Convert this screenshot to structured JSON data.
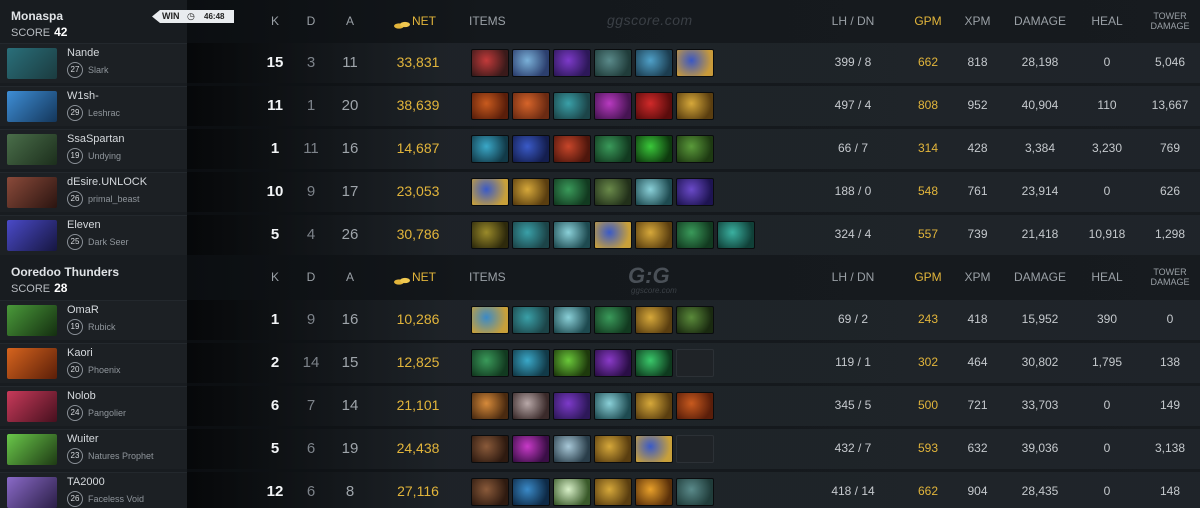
{
  "match": {
    "result": "WIN",
    "duration": "46:48",
    "watermark": "ggscore.com",
    "logo": "G:G",
    "logo_sub": "ggscore.com"
  },
  "colors": {
    "gold": "#e2b53b",
    "background": "#0d1013"
  },
  "headers": {
    "k": "K",
    "d": "D",
    "a": "A",
    "net": "NET",
    "items": "ITEMS",
    "lhdn": "LH / DN",
    "gpm": "GPM",
    "xpm": "XPM",
    "damage": "DAMAGE",
    "heal": "HEAL",
    "tower1": "TOWER",
    "tower2": "DAMAGE",
    "score_label": "SCORE"
  },
  "teams": [
    {
      "name": "Monaspa",
      "score": "42",
      "players": [
        {
          "name": "Nande",
          "level": "27",
          "hero": "Slark",
          "k": "15",
          "d": "3",
          "a": "11",
          "net": "33,831",
          "lhdn": "399 / 8",
          "gpm": "662",
          "xpm": "818",
          "damage": "28,198",
          "heal": "0",
          "tower": "5,046",
          "portrait": [
            "#2a6f7a",
            "#1b3b3f"
          ],
          "items": [
            [
              "#c23a3a",
              "#3a1a1a"
            ],
            [
              "#7ab0d8",
              "#2c3f6e"
            ],
            [
              "#7d3ac9",
              "#2d1859"
            ],
            [
              "#5a8a8a",
              "#203c3a"
            ],
            [
              "#4fa0c8",
              "#1c3d50"
            ],
            [
              "#3a57c4",
              "#c89a3a"
            ]
          ]
        },
        {
          "name": "W1sh-",
          "level": "29",
          "hero": "Leshrac",
          "k": "11",
          "d": "1",
          "a": "20",
          "net": "38,639",
          "lhdn": "497 / 4",
          "gpm": "808",
          "xpm": "952",
          "damage": "40,904",
          "heal": "110",
          "tower": "13,667",
          "portrait": [
            "#3e8ed6",
            "#14365a"
          ],
          "items": [
            [
              "#c85a1e",
              "#5a1e0a"
            ],
            [
              "#d6642a",
              "#6a2a12"
            ],
            [
              "#3aa0a8",
              "#1c4448"
            ],
            [
              "#b83ac0",
              "#461452"
            ],
            [
              "#d02a2a",
              "#5a0c0c"
            ],
            [
              "#d6a83a",
              "#5a3e10"
            ]
          ]
        },
        {
          "name": "SsaSpartan",
          "level": "19",
          "hero": "Undying",
          "k": "1",
          "d": "11",
          "a": "16",
          "net": "14,687",
          "lhdn": "66 / 7",
          "gpm": "314",
          "xpm": "428",
          "damage": "3,384",
          "heal": "3,230",
          "tower": "769",
          "portrait": [
            "#4a6e4a",
            "#1c2e1c"
          ],
          "items": [
            [
              "#3aa8c8",
              "#123a48"
            ],
            [
              "#3a5ac8",
              "#141e4e"
            ],
            [
              "#c8462a",
              "#4e160c"
            ],
            [
              "#3a9a5a",
              "#123a20"
            ],
            [
              "#3ac83a",
              "#0e3a0e"
            ],
            [
              "#5a9a3a",
              "#1e3a12"
            ]
          ]
        },
        {
          "name": "dEsire.UNLOCK",
          "level": "26",
          "hero": "primal_beast",
          "k": "10",
          "d": "9",
          "a": "17",
          "net": "23,053",
          "lhdn": "188 / 0",
          "gpm": "548",
          "xpm": "761",
          "damage": "23,914",
          "heal": "0",
          "tower": "626",
          "portrait": [
            "#8a4a3a",
            "#2a1410"
          ],
          "items": [
            [
              "#3a5ac8",
              "#c8a03a"
            ],
            [
              "#d6a83a",
              "#5a3e10"
            ],
            [
              "#3a9a5a",
              "#123a20"
            ],
            [
              "#6a8a4a",
              "#22301a"
            ],
            [
              "#8ad0d8",
              "#1e4a50"
            ],
            [
              "#6a4ac8",
              "#1e1452"
            ]
          ]
        },
        {
          "name": "Eleven",
          "level": "25",
          "hero": "Dark Seer",
          "k": "5",
          "d": "4",
          "a": "26",
          "net": "30,786",
          "lhdn": "324 / 4",
          "gpm": "557",
          "xpm": "739",
          "damage": "21,418",
          "heal": "10,918",
          "tower": "1,298",
          "portrait": [
            "#4a4ac8",
            "#161640"
          ],
          "items": [
            [
              "#9a8a2a",
              "#2e2a0c"
            ],
            [
              "#3aa0a8",
              "#1c4448"
            ],
            [
              "#8ad0d8",
              "#1e4a50"
            ],
            [
              "#3a5ac8",
              "#c8a03a"
            ],
            [
              "#d6a83a",
              "#5a3e10"
            ],
            [
              "#3a9a5a",
              "#123a20"
            ],
            [
              "#3ab0a0",
              "#104038"
            ]
          ]
        }
      ]
    },
    {
      "name": "Ooredoo Thunders",
      "score": "28",
      "players": [
        {
          "name": "OmaR",
          "level": "19",
          "hero": "Rubick",
          "k": "1",
          "d": "9",
          "a": "16",
          "net": "10,286",
          "lhdn": "69 / 2",
          "gpm": "243",
          "xpm": "418",
          "damage": "15,952",
          "heal": "390",
          "tower": "0",
          "portrait": [
            "#4a9a3a",
            "#142e10"
          ],
          "items": [
            [
              "#3a8ac8",
              "#c8a03a"
            ],
            [
              "#3aa0a8",
              "#1c4448"
            ],
            [
              "#8ad0d8",
              "#1e4a50"
            ],
            [
              "#3a9a5a",
              "#123a20"
            ],
            [
              "#d6a83a",
              "#5a3e10"
            ],
            [
              "#5a8a3a",
              "#1a2a10"
            ]
          ]
        },
        {
          "name": "Kaori",
          "level": "20",
          "hero": "Phoenix",
          "k": "2",
          "d": "14",
          "a": "15",
          "net": "12,825",
          "lhdn": "119 / 1",
          "gpm": "302",
          "xpm": "464",
          "damage": "30,802",
          "heal": "1,795",
          "tower": "138",
          "portrait": [
            "#d6641e",
            "#5a1e08"
          ],
          "items": [
            [
              "#3a9a5a",
              "#123a20"
            ],
            [
              "#3aa8c8",
              "#123a48"
            ],
            [
              "#6ac83a",
              "#1e3a0c"
            ],
            [
              "#8a3ac8",
              "#2a0e46"
            ],
            [
              "#3ac86a",
              "#0e3a1e"
            ]
          ]
        },
        {
          "name": "Nolob",
          "level": "24",
          "hero": "Pangolier",
          "k": "6",
          "d": "7",
          "a": "14",
          "net": "21,101",
          "lhdn": "345 / 5",
          "gpm": "500",
          "xpm": "721",
          "damage": "33,703",
          "heal": "0",
          "tower": "149",
          "portrait": [
            "#c83a5a",
            "#46101e"
          ],
          "items": [
            [
              "#d68a3a",
              "#4a2a10"
            ],
            [
              "#b8a8a8",
              "#3a2a2a"
            ],
            [
              "#7d3ac9",
              "#2d1859"
            ],
            [
              "#8ad0d8",
              "#1e4a50"
            ],
            [
              "#d6a83a",
              "#5a3e10"
            ],
            [
              "#c85a1e",
              "#5a1e0a"
            ]
          ]
        },
        {
          "name": "Wuiter",
          "level": "23",
          "hero": "Natures Prophet",
          "k": "5",
          "d": "6",
          "a": "19",
          "net": "24,438",
          "lhdn": "432 / 7",
          "gpm": "593",
          "xpm": "632",
          "damage": "39,036",
          "heal": "0",
          "tower": "3,138",
          "portrait": [
            "#6ac84a",
            "#1e3a14"
          ],
          "items": [
            [
              "#8a5a3a",
              "#2e1a10"
            ],
            [
              "#c83ac8",
              "#3a0e46"
            ],
            [
              "#a8c8d8",
              "#2a3e4a"
            ],
            [
              "#d6a83a",
              "#5a3e10"
            ],
            [
              "#3a5ac8",
              "#c8a03a"
            ]
          ]
        },
        {
          "name": "TA2000",
          "level": "26",
          "hero": "Faceless Void",
          "k": "12",
          "d": "6",
          "a": "8",
          "net": "27,116",
          "lhdn": "418 / 14",
          "gpm": "662",
          "xpm": "904",
          "damage": "28,435",
          "heal": "0",
          "tower": "148",
          "portrait": [
            "#8a6ac8",
            "#2a1e46"
          ],
          "items": [
            [
              "#8a5a3a",
              "#2e1a10"
            ],
            [
              "#3a8ac8",
              "#0e2a46"
            ],
            [
              "#d8f0c8",
              "#3a5a2a"
            ],
            [
              "#d6a83a",
              "#5a3e10"
            ],
            [
              "#e8a02a",
              "#5a300a"
            ],
            [
              "#5a8a8a",
              "#203c3a"
            ]
          ]
        }
      ]
    }
  ]
}
